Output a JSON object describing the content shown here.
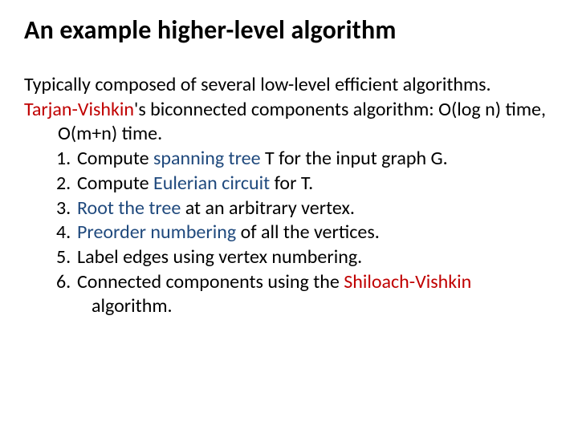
{
  "title": "An example higher-level algorithm",
  "intro": "Typically composed of several low-level efficient algorithms.",
  "tv_name": "Tarjan-Vishkin",
  "tv_rest": "'s biconnected components algorithm: O(log n) time, O(m+n) time.",
  "items": [
    {
      "num": "1.",
      "pre": "Compute ",
      "hl": "spanning tree",
      "post": " T for the input graph G.",
      "cls": "accent-blue"
    },
    {
      "num": "2.",
      "pre": "Compute ",
      "hl": "Eulerian circuit",
      "post": " for T.",
      "cls": "accent-blue"
    },
    {
      "num": "3.",
      "pre": "",
      "hl": "Root the tree",
      "post": " at an arbitrary vertex.",
      "cls": "accent-blue"
    },
    {
      "num": "4.",
      "pre": "",
      "hl": "Preorder numbering",
      "post": " of all the vertices.",
      "cls": "accent-blue"
    },
    {
      "num": "5.",
      "pre": "Label edges using vertex numbering.",
      "hl": "",
      "post": "",
      "cls": ""
    },
    {
      "num": "6.",
      "pre": "Connected components using the ",
      "hl": "Shiloach-Vishkin",
      "post": " algorithm.",
      "cls": "accent-red"
    }
  ]
}
